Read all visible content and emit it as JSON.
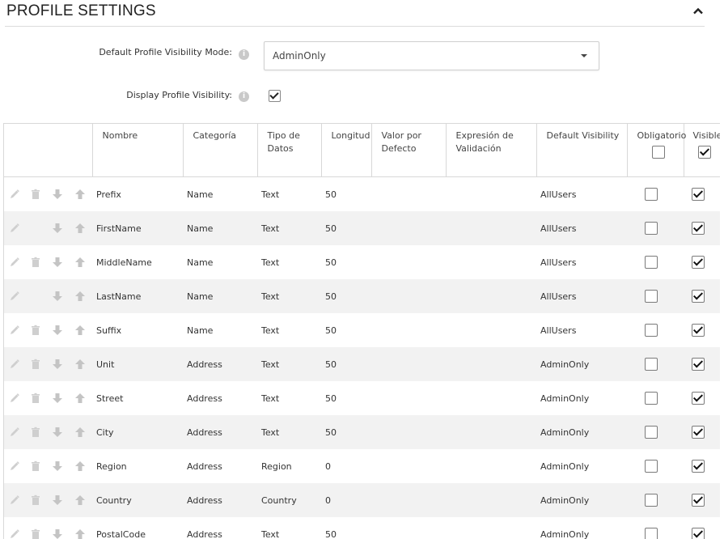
{
  "header": {
    "title": "PROFILE SETTINGS"
  },
  "form": {
    "visibility_mode_label": "Default Profile Visibility Mode:",
    "visibility_mode_value": "AdminOnly",
    "display_visibility_label": "Display Profile Visibility:",
    "display_visibility_checked": true,
    "info_glyph": "i"
  },
  "table": {
    "columns": {
      "nombre": "Nombre",
      "categoria": "Categoría",
      "tipo_line1": "Tipo de",
      "tipo_line2": "Datos",
      "longitud": "Longitud",
      "valor_line1": "Valor por",
      "valor_line2": "Defecto",
      "expr_line1": "Expresión de",
      "expr_line2": "Validación",
      "default_visibility": "Default Visibility",
      "obligatorio": "Obligatorio",
      "visible": "Visible"
    },
    "header_required_checked": false,
    "header_visible_checked": true,
    "rows": [
      {
        "name": "Prefix",
        "category": "Name",
        "type": "Text",
        "length": "50",
        "default": "",
        "validation": "",
        "visibility": "AllUsers",
        "required": false,
        "visible": true,
        "deletable": true
      },
      {
        "name": "FirstName",
        "category": "Name",
        "type": "Text",
        "length": "50",
        "default": "",
        "validation": "",
        "visibility": "AllUsers",
        "required": false,
        "visible": true,
        "deletable": false
      },
      {
        "name": "MiddleName",
        "category": "Name",
        "type": "Text",
        "length": "50",
        "default": "",
        "validation": "",
        "visibility": "AllUsers",
        "required": false,
        "visible": true,
        "deletable": true
      },
      {
        "name": "LastName",
        "category": "Name",
        "type": "Text",
        "length": "50",
        "default": "",
        "validation": "",
        "visibility": "AllUsers",
        "required": false,
        "visible": true,
        "deletable": false
      },
      {
        "name": "Suffix",
        "category": "Name",
        "type": "Text",
        "length": "50",
        "default": "",
        "validation": "",
        "visibility": "AllUsers",
        "required": false,
        "visible": true,
        "deletable": true
      },
      {
        "name": "Unit",
        "category": "Address",
        "type": "Text",
        "length": "50",
        "default": "",
        "validation": "",
        "visibility": "AdminOnly",
        "required": false,
        "visible": true,
        "deletable": true
      },
      {
        "name": "Street",
        "category": "Address",
        "type": "Text",
        "length": "50",
        "default": "",
        "validation": "",
        "visibility": "AdminOnly",
        "required": false,
        "visible": true,
        "deletable": true
      },
      {
        "name": "City",
        "category": "Address",
        "type": "Text",
        "length": "50",
        "default": "",
        "validation": "",
        "visibility": "AdminOnly",
        "required": false,
        "visible": true,
        "deletable": true
      },
      {
        "name": "Region",
        "category": "Address",
        "type": "Region",
        "length": "0",
        "default": "",
        "validation": "",
        "visibility": "AdminOnly",
        "required": false,
        "visible": true,
        "deletable": true
      },
      {
        "name": "Country",
        "category": "Address",
        "type": "Country",
        "length": "0",
        "default": "",
        "validation": "",
        "visibility": "AdminOnly",
        "required": false,
        "visible": true,
        "deletable": true
      },
      {
        "name": "PostalCode",
        "category": "Address",
        "type": "Text",
        "length": "50",
        "default": "",
        "validation": "",
        "visibility": "AdminOnly",
        "required": false,
        "visible": true,
        "deletable": true
      }
    ]
  },
  "icons": {
    "collapse": "chevron-up-icon",
    "edit": "pencil-icon",
    "delete": "trash-icon",
    "down": "arrow-down-icon",
    "up": "arrow-up-icon",
    "info": "info-icon"
  },
  "colors": {
    "icon_gray": "#c8c8c8",
    "row_alt": "#f2f2f2",
    "border": "#d8d8d8"
  }
}
